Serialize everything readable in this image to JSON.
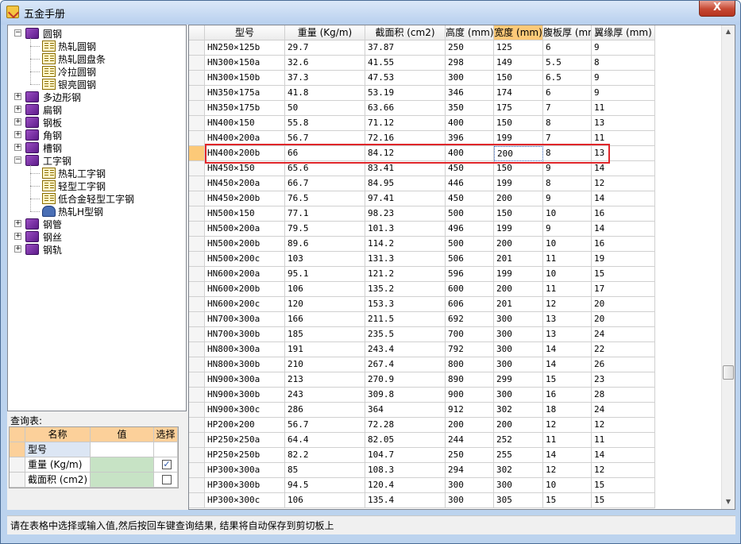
{
  "window": {
    "title": "五金手册",
    "close_glyph": "X"
  },
  "tree": {
    "items": [
      {
        "label": "圆钢",
        "expander": "−",
        "icon": "book-purple-icon",
        "level": 0
      },
      {
        "label": "热轧圆钢",
        "icon": "book-open-icon",
        "level": 1
      },
      {
        "label": "热轧圆盘条",
        "icon": "book-open-icon",
        "level": 1
      },
      {
        "label": "冷拉圆钢",
        "icon": "book-open-icon",
        "level": 1
      },
      {
        "label": "银亮圆钢",
        "icon": "book-open-icon",
        "level": 1
      },
      {
        "label": "多边形钢",
        "expander": "+",
        "icon": "book-purple-icon",
        "level": 0
      },
      {
        "label": "扁钢",
        "expander": "+",
        "icon": "book-purple-icon",
        "level": 0
      },
      {
        "label": "钢板",
        "expander": "+",
        "icon": "book-purple-icon",
        "level": 0
      },
      {
        "label": "角钢",
        "expander": "+",
        "icon": "book-purple-icon",
        "level": 0
      },
      {
        "label": "槽钢",
        "expander": "+",
        "icon": "book-purple-icon",
        "level": 0
      },
      {
        "label": "工字钢",
        "expander": "−",
        "icon": "book-purple-icon",
        "level": 0
      },
      {
        "label": "热轧工字钢",
        "icon": "book-open-icon",
        "level": 1
      },
      {
        "label": "轻型工字钢",
        "icon": "book-open-icon",
        "level": 1
      },
      {
        "label": "低合金轻型工字钢",
        "icon": "book-open-icon",
        "level": 1
      },
      {
        "label": "热轧H型钢",
        "icon": "binoculars-icon",
        "level": 1
      },
      {
        "label": "钢管",
        "expander": "+",
        "icon": "book-purple-icon",
        "level": 0
      },
      {
        "label": "钢丝",
        "expander": "+",
        "icon": "book-purple-icon",
        "level": 0
      },
      {
        "label": "钢轨",
        "expander": "+",
        "icon": "book-purple-icon",
        "level": 0
      }
    ]
  },
  "query": {
    "label": "查询表:",
    "headers": {
      "name": "名称",
      "value": "值",
      "select": "选择"
    },
    "rows": [
      {
        "name": "型号",
        "value": "",
        "checked": null
      },
      {
        "name": "重量 (Kg/m)",
        "value": "",
        "checked": true
      },
      {
        "name": "截面积 (cm2)",
        "value": "",
        "checked": false
      }
    ]
  },
  "grid": {
    "columns": [
      "型号",
      "重量 (Kg/m)",
      "截面积 (cm2)",
      "高度 (mm)",
      "宽度 (mm)",
      "腹板厚 (mm",
      "翼缘厚 (mm)"
    ],
    "active_column": 4,
    "selected_row": 7,
    "rows": [
      [
        "HN250×125b",
        "29.7",
        "37.87",
        "250",
        "125",
        "6",
        "9"
      ],
      [
        "HN300×150a",
        "32.6",
        "41.55",
        "298",
        "149",
        "5.5",
        "8"
      ],
      [
        "HN300×150b",
        "37.3",
        "47.53",
        "300",
        "150",
        "6.5",
        "9"
      ],
      [
        "HN350×175a",
        "41.8",
        "53.19",
        "346",
        "174",
        "6",
        "9"
      ],
      [
        "HN350×175b",
        "50",
        "63.66",
        "350",
        "175",
        "7",
        "11"
      ],
      [
        "HN400×150",
        "55.8",
        "71.12",
        "400",
        "150",
        "8",
        "13"
      ],
      [
        "HN400×200a",
        "56.7",
        "72.16",
        "396",
        "199",
        "7",
        "11"
      ],
      [
        "HN400×200b",
        "66",
        "84.12",
        "400",
        "200",
        "8",
        "13"
      ],
      [
        "HN450×150",
        "65.6",
        "83.41",
        "450",
        "150",
        "9",
        "14"
      ],
      [
        "HN450×200a",
        "66.7",
        "84.95",
        "446",
        "199",
        "8",
        "12"
      ],
      [
        "HN450×200b",
        "76.5",
        "97.41",
        "450",
        "200",
        "9",
        "14"
      ],
      [
        "HN500×150",
        "77.1",
        "98.23",
        "500",
        "150",
        "10",
        "16"
      ],
      [
        "HN500×200a",
        "79.5",
        "101.3",
        "496",
        "199",
        "9",
        "14"
      ],
      [
        "HN500×200b",
        "89.6",
        "114.2",
        "500",
        "200",
        "10",
        "16"
      ],
      [
        "HN500×200c",
        "103",
        "131.3",
        "506",
        "201",
        "11",
        "19"
      ],
      [
        "HN600×200a",
        "95.1",
        "121.2",
        "596",
        "199",
        "10",
        "15"
      ],
      [
        "HN600×200b",
        "106",
        "135.2",
        "600",
        "200",
        "11",
        "17"
      ],
      [
        "HN600×200c",
        "120",
        "153.3",
        "606",
        "201",
        "12",
        "20"
      ],
      [
        "HN700×300a",
        "166",
        "211.5",
        "692",
        "300",
        "13",
        "20"
      ],
      [
        "HN700×300b",
        "185",
        "235.5",
        "700",
        "300",
        "13",
        "24"
      ],
      [
        "HN800×300a",
        "191",
        "243.4",
        "792",
        "300",
        "14",
        "22"
      ],
      [
        "HN800×300b",
        "210",
        "267.4",
        "800",
        "300",
        "14",
        "26"
      ],
      [
        "HN900×300a",
        "213",
        "270.9",
        "890",
        "299",
        "15",
        "23"
      ],
      [
        "HN900×300b",
        "243",
        "309.8",
        "900",
        "300",
        "16",
        "28"
      ],
      [
        "HN900×300c",
        "286",
        "364",
        "912",
        "302",
        "18",
        "24"
      ],
      [
        "HP200×200",
        "56.7",
        "72.28",
        "200",
        "200",
        "12",
        "12"
      ],
      [
        "HP250×250a",
        "64.4",
        "82.05",
        "244",
        "252",
        "11",
        "11"
      ],
      [
        "HP250×250b",
        "82.2",
        "104.7",
        "250",
        "255",
        "14",
        "14"
      ],
      [
        "HP300×300a",
        "85",
        "108.3",
        "294",
        "302",
        "12",
        "12"
      ],
      [
        "HP300×300b",
        "94.5",
        "120.4",
        "300",
        "300",
        "10",
        "15"
      ],
      [
        "HP300×300c",
        "106",
        "135.4",
        "300",
        "305",
        "15",
        "15"
      ]
    ]
  },
  "scrollbar": {
    "up": "▲",
    "down": "▼"
  },
  "status": {
    "text": "请在表格中选择或输入值,然后按回车键查询结果, 结果将自动保存到剪切板上"
  },
  "colors": {
    "highlight": "#e0262a",
    "header_active": "#fcc978",
    "value_cell": "#c7e3c5"
  }
}
